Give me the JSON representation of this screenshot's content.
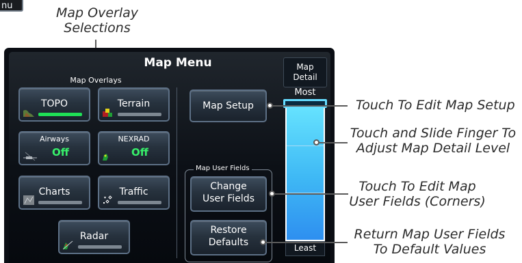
{
  "fragment": {
    "text": "nu"
  },
  "callouts": {
    "overlay_line1": "Map Overlay",
    "overlay_line2": "Selections",
    "edit_setup": "Touch To Edit Map Setup",
    "slide_line1": "Touch and Slide Finger To",
    "slide_line2": "Adjust Map Detail Level",
    "user_fields_line1": "Touch To Edit Map",
    "user_fields_line2": "User Fields (Corners)",
    "return_line1": "Return Map User Fields",
    "return_line2": "To Default Values"
  },
  "menu": {
    "title": "Map Menu",
    "overlays_label": "Map Overlays",
    "overlay_buttons": [
      {
        "label": "TOPO",
        "indicator": "on"
      },
      {
        "label": "Terrain",
        "indicator": "off"
      },
      {
        "label": "Airways",
        "value": "Off"
      },
      {
        "label": "NEXRAD",
        "value": "Off"
      },
      {
        "label": "Charts",
        "indicator": "off"
      },
      {
        "label": "Traffic",
        "indicator": "off"
      },
      {
        "label": "Radar",
        "indicator": "off"
      }
    ],
    "map_setup_label": "Map Setup",
    "user_fields_group_label": "Map User Fields",
    "change_user_fields_line1": "Change",
    "change_user_fields_line2": "User Fields",
    "restore_defaults_line1": "Restore",
    "restore_defaults_line2": "Defaults"
  },
  "detail": {
    "header_line1": "Map",
    "header_line2": "Detail",
    "most_label": "Most",
    "least_label": "Least",
    "level": "most"
  },
  "colors": {
    "indicator_on": "#1fe056",
    "value_green": "#37f06a",
    "slider_blue": "#3fb9f5",
    "button_border": "#5d7086"
  },
  "icons": {
    "topo": "topo-map-thumbnail-icon",
    "terrain": "terrain-thumbnail-icon",
    "airways": "airways-thumbnail-icon",
    "nexrad": "nexrad-thumbnail-icon",
    "charts": "charts-thumbnail-icon",
    "traffic": "traffic-thumbnail-icon",
    "radar": "radar-thumbnail-icon"
  }
}
